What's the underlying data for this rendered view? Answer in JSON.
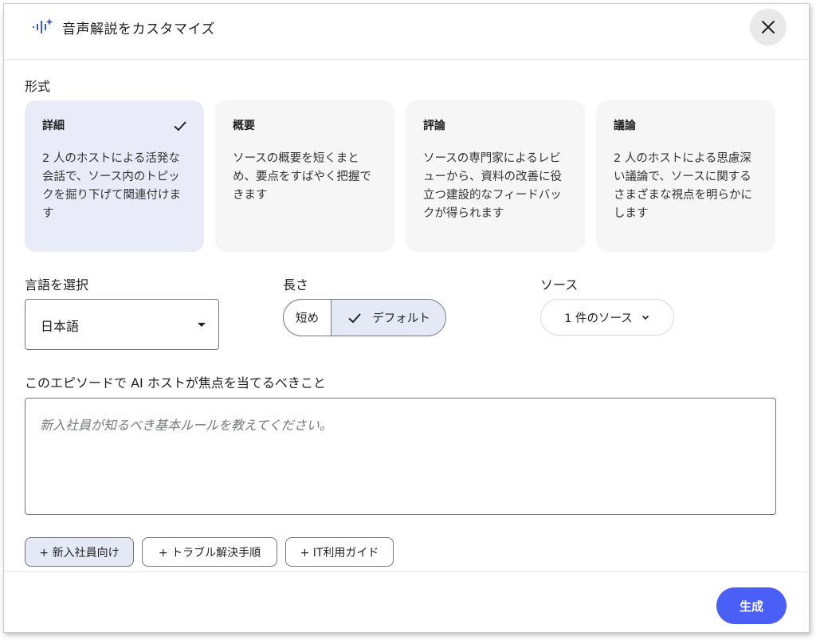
{
  "dialog": {
    "title": "音声解説をカスタマイズ",
    "close_icon": "close-icon"
  },
  "format": {
    "label": "形式",
    "cards": [
      {
        "title": "詳細",
        "desc": "2 人のホストによる活発な会話で、ソース内のトピックを掘り下げて関連付けます",
        "selected": true
      },
      {
        "title": "概要",
        "desc": "ソースの概要を短くまとめ、要点をすばやく把握できます",
        "selected": false
      },
      {
        "title": "評論",
        "desc": "ソースの専門家によるレビューから、資料の改善に役立つ建設的なフィードバックが得られます",
        "selected": false
      },
      {
        "title": "議論",
        "desc": "2 人のホストによる思慮深い議論で、ソースに関するさまざまな視点を明らかにします",
        "selected": false
      }
    ]
  },
  "language": {
    "label": "言語を選択",
    "value": "日本語"
  },
  "length": {
    "label": "長さ",
    "options": [
      "短め",
      "デフォルト"
    ],
    "selected": "デフォルト"
  },
  "source": {
    "label": "ソース",
    "button": "1 件のソース"
  },
  "focus": {
    "label": "このエピソードで AI ホストが焦点を当てるべきこと",
    "placeholder": "新入社員が知るべき基本ルールを教えてください。",
    "value": ""
  },
  "suggestions": [
    {
      "label": "+ 新入社員向け",
      "active": true
    },
    {
      "label": "+ トラブル解決手順",
      "active": false
    },
    {
      "label": "+ IT利用ガイド",
      "active": false
    }
  ],
  "footer": {
    "generate_label": "生成"
  },
  "colors": {
    "accent": "#4a5ff5",
    "selected_bg": "#e9ecf8",
    "card_bg": "#f6f6f6"
  }
}
